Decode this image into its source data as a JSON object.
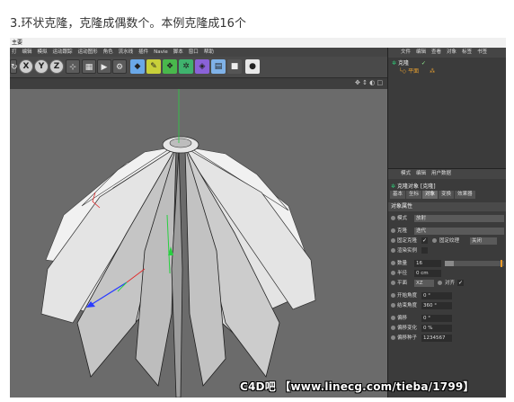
{
  "heading": "3.环状克隆，克隆成偶数个。本例克隆成16个",
  "app": {
    "title": "主要",
    "menu": [
      "打",
      "编辑",
      "模拟",
      "运动跟踪",
      "运动图形",
      "角色",
      "流水线",
      "插件",
      "Navie",
      "脚本",
      "窗口",
      "帮助"
    ],
    "toolbar_axes": [
      "X",
      "Y",
      "Z"
    ]
  },
  "object_manager": {
    "menu": [
      "文件",
      "编辑",
      "查看",
      "对象",
      "标签",
      "书签"
    ],
    "items": [
      {
        "label": "克隆",
        "icon": "cloner-icon"
      },
      {
        "label": "平面",
        "icon": "plane-icon"
      }
    ]
  },
  "attribute_manager": {
    "menu": [
      "模式",
      "编辑",
      "用户数据"
    ],
    "object_title": "克隆对象 [克隆]",
    "tabs": [
      "基本",
      "坐标",
      "对象",
      "变换",
      "效果器"
    ],
    "active_tab": "对象",
    "section_title": "对象属性",
    "fields": {
      "mode_label": "模式",
      "mode_value": "放射",
      "clones_label": "克隆",
      "clones_value": "迭代",
      "fixed_clone_label": "固定克隆",
      "fixed_texture_label": "固定纹理",
      "fixed_texture_value": "关闭",
      "render_instance_label": "渲染实例",
      "count_label": "数量",
      "count_value": "16",
      "radius_label": "半径",
      "radius_value": "0 cm",
      "plane_label": "平面",
      "plane_value": "XZ",
      "align_label": "对齐",
      "start_angle_label": "开始角度",
      "start_angle_value": "0 °",
      "end_angle_label": "结束角度",
      "end_angle_value": "360 °",
      "offset_label": "偏移",
      "offset_value": "0 °",
      "offset_var_label": "偏移变化",
      "offset_var_value": "0 %",
      "offset_seed_label": "偏移种子",
      "offset_seed_value": "1234567"
    }
  },
  "watermark": "C4D吧 【www.linecg.com/tieba/1799】",
  "colors": {
    "viewport_bg": "#6b6b6b",
    "panel_bg": "#3b3b3b",
    "accent_orange": "#e89a2a",
    "axis_green": "#28d040",
    "axis_blue": "#2a3cff",
    "axis_red": "#e02a2a"
  }
}
